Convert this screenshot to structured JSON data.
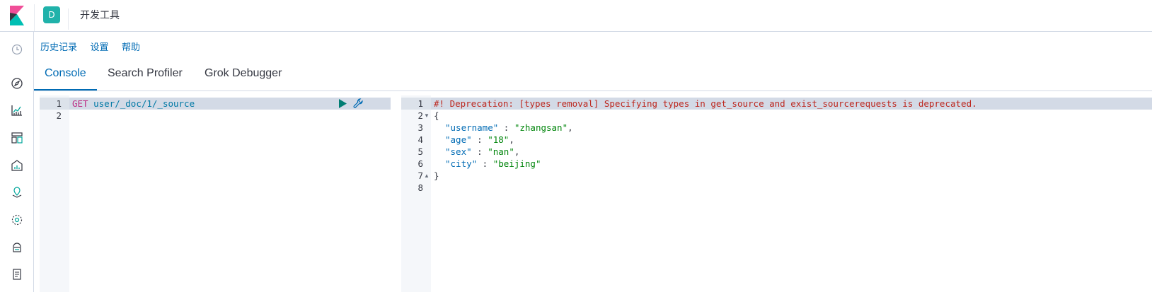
{
  "header": {
    "space_initial": "D",
    "title": "开发工具"
  },
  "nav_icons": [
    "history-icon",
    "discover-icon",
    "visualize-icon",
    "dashboard-icon",
    "canvas-icon",
    "maps-icon",
    "ml-icon",
    "infrastructure-icon",
    "logs-icon"
  ],
  "toplinks": [
    "历史记录",
    "设置",
    "帮助"
  ],
  "tabs": [
    "Console",
    "Search Profiler",
    "Grok Debugger"
  ],
  "active_tab": "Console",
  "request_editor": {
    "lines": [
      {
        "num": "1",
        "method": "GET",
        "path": "user/_doc/1/_source"
      },
      {
        "num": "2",
        "method": "",
        "path": ""
      }
    ]
  },
  "response_editor": {
    "lines": [
      {
        "num": "1",
        "text": "#! Deprecation: [types removal] Specifying types in get_source and exist_sourcerequests is deprecated."
      },
      {
        "num": "2",
        "text": "{"
      },
      {
        "num": "3",
        "key": "\"username\"",
        "value": "\"zhangsan\"",
        "trail": ","
      },
      {
        "num": "4",
        "key": "\"age\"",
        "value": "\"18\"",
        "trail": ","
      },
      {
        "num": "5",
        "key": "\"sex\"",
        "value": "\"nan\"",
        "trail": ","
      },
      {
        "num": "6",
        "key": "\"city\"",
        "value": "\"beijing\"",
        "trail": ""
      },
      {
        "num": "7",
        "text": "}"
      },
      {
        "num": "8",
        "text": ""
      }
    ]
  },
  "colors": {
    "accent": "#006bb4",
    "badge": "#20b2aa",
    "method": "#bd2c83",
    "deprecation": "#bd271e",
    "string": "#00850b"
  }
}
